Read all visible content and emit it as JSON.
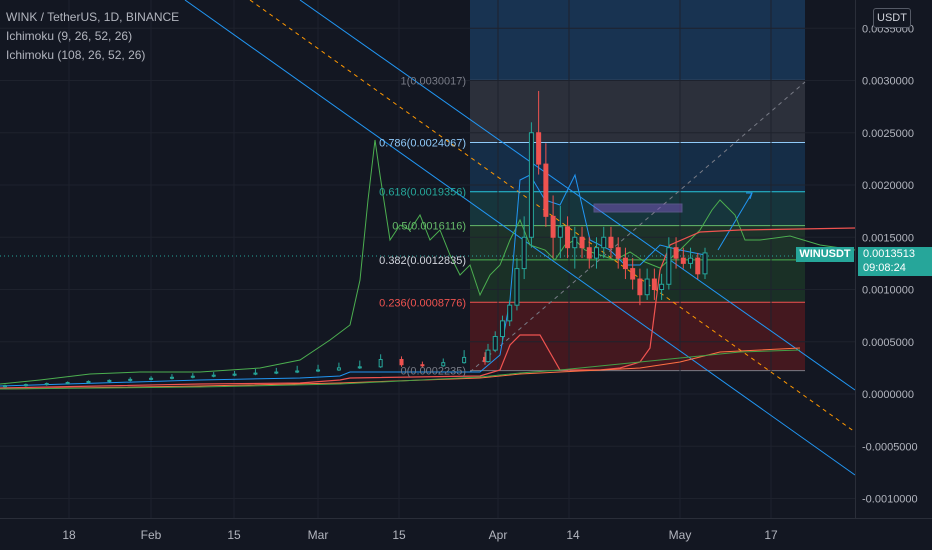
{
  "header": {
    "symbol_line": "WINK / TetherUS, 1D, BINANCE",
    "indicator1": "Ichimoku (9, 26, 52, 26)",
    "indicator2": "Ichimoku (108, 26, 52, 26)",
    "currency": "USDT"
  },
  "price_tag": {
    "symbol": "WINUSDT",
    "price": "0.0013513",
    "countdown": "09:08:24"
  },
  "colors": {
    "background": "#131722",
    "up": "#26a69a",
    "down": "#ef5350",
    "channel": "#2196f3",
    "fib_text_top": "#787b86"
  },
  "chart_data": {
    "type": "candlestick",
    "title": "WINK / TetherUS, 1D, BINANCE",
    "y_axis": {
      "ylim": [
        -0.0012,
        0.0036
      ],
      "ticks": [
        "0.0035000",
        "0.0030000",
        "0.0025000",
        "0.0020000",
        "0.0015000",
        "0.0010000",
        "0.0005000",
        "0.0000000",
        "-0.0005000",
        "-0.0010000"
      ]
    },
    "x_axis": {
      "ticks": [
        "18",
        "Feb",
        "15",
        "Mar",
        "15",
        "Apr",
        "14",
        "May",
        "17"
      ]
    },
    "fib_levels": [
      {
        "label": "1(0.0030017)",
        "ratio": "1",
        "value": 0.0030017
      },
      {
        "label": "0.786(0.0024067)",
        "ratio": "0.786",
        "value": 0.0024067
      },
      {
        "label": "0.618(0.0019356)",
        "ratio": "0.618",
        "value": 0.0019356
      },
      {
        "label": "0.5(0.0016116)",
        "ratio": "0.5",
        "value": 0.0016116
      },
      {
        "label": "0.382(0.0012835)",
        "ratio": "0.382",
        "value": 0.0012835
      },
      {
        "label": "0.236(0.0008776)",
        "ratio": "0.236",
        "value": 0.0008776
      },
      {
        "label": "0(0.0002235)",
        "ratio": "0",
        "value": 0.0002235
      }
    ],
    "last_price": 0.0013513,
    "candles": [
      [
        7e-05,
        9e-05,
        6e-05,
        8e-05
      ],
      [
        8e-05,
        0.0001,
        7e-05,
        9e-05
      ],
      [
        9e-05,
        0.00011,
        8e-05,
        0.0001
      ],
      [
        0.0001,
        0.00012,
        9e-05,
        0.00011
      ],
      [
        0.00011,
        0.00013,
        0.0001,
        0.00012
      ],
      [
        0.00012,
        0.00014,
        0.00011,
        0.00013
      ],
      [
        0.00013,
        0.00016,
        0.00012,
        0.00014
      ],
      [
        0.00014,
        0.00017,
        0.00013,
        0.00015
      ],
      [
        0.00015,
        0.00019,
        0.00014,
        0.00016
      ],
      [
        0.00016,
        0.0002,
        0.00015,
        0.00017
      ],
      [
        0.00017,
        0.00021,
        0.00016,
        0.00018
      ],
      [
        0.00018,
        0.00022,
        0.00017,
        0.00019
      ],
      [
        0.00019,
        0.00024,
        0.00018,
        0.0002
      ],
      [
        0.0002,
        0.00025,
        0.00019,
        0.00021
      ],
      [
        0.00021,
        0.00027,
        0.0002,
        0.00022
      ],
      [
        0.00022,
        0.00028,
        0.00021,
        0.00023
      ],
      [
        0.00023,
        0.0003,
        0.00022,
        0.00025
      ],
      [
        0.00025,
        0.00032,
        0.00024,
        0.00026
      ],
      [
        0.00026,
        0.00038,
        0.00025,
        0.00033
      ],
      [
        0.00033,
        0.00036,
        0.00026,
        0.00028
      ],
      [
        0.00028,
        0.00031,
        0.00025,
        0.00027
      ],
      [
        0.00027,
        0.00034,
        0.00026,
        0.0003
      ],
      [
        0.0003,
        0.00042,
        0.00029,
        0.00035
      ],
      [
        0.00035,
        0.0004,
        0.00028,
        0.00031
      ],
      [
        0.00031,
        0.00048,
        0.0003,
        0.00042
      ],
      [
        0.00042,
        0.0006,
        0.0004,
        0.00055
      ],
      [
        0.00055,
        0.00075,
        0.0005,
        0.0007
      ],
      [
        0.0007,
        0.0009,
        0.00065,
        0.00085
      ],
      [
        0.00085,
        0.0013,
        0.0008,
        0.0012
      ],
      [
        0.0012,
        0.0017,
        0.0011,
        0.0015
      ],
      [
        0.0015,
        0.0026,
        0.0014,
        0.0025
      ],
      [
        0.0025,
        0.0029,
        0.0021,
        0.0022
      ],
      [
        0.0022,
        0.0024,
        0.0016,
        0.0017
      ],
      [
        0.0017,
        0.0019,
        0.0013,
        0.0015
      ],
      [
        0.0015,
        0.0018,
        0.0013,
        0.0016
      ],
      [
        0.0016,
        0.0017,
        0.0013,
        0.0014
      ],
      [
        0.0014,
        0.0016,
        0.0012,
        0.0015
      ],
      [
        0.0015,
        0.0016,
        0.0013,
        0.0014
      ],
      [
        0.0014,
        0.0015,
        0.0012,
        0.0013
      ],
      [
        0.0013,
        0.0015,
        0.0012,
        0.0014
      ],
      [
        0.0014,
        0.0016,
        0.0013,
        0.0015
      ],
      [
        0.0015,
        0.0016,
        0.0013,
        0.0014
      ],
      [
        0.0014,
        0.0015,
        0.0012,
        0.0013
      ],
      [
        0.0013,
        0.0014,
        0.0011,
        0.0012
      ],
      [
        0.0012,
        0.0013,
        0.001,
        0.0011
      ],
      [
        0.0011,
        0.0012,
        0.00085,
        0.00095
      ],
      [
        0.00095,
        0.0012,
        0.0009,
        0.0011
      ],
      [
        0.0011,
        0.0012,
        0.0009,
        0.001
      ],
      [
        0.001,
        0.00115,
        0.0009,
        0.00105
      ],
      [
        0.00105,
        0.0015,
        0.001,
        0.0014
      ],
      [
        0.0014,
        0.0015,
        0.0012,
        0.0013
      ],
      [
        0.0013,
        0.0014,
        0.0012,
        0.00125
      ],
      [
        0.00125,
        0.0014,
        0.0012,
        0.0013
      ],
      [
        0.0013,
        0.00135,
        0.0011,
        0.00115
      ],
      [
        0.00115,
        0.0014,
        0.0011,
        0.00135
      ]
    ]
  }
}
